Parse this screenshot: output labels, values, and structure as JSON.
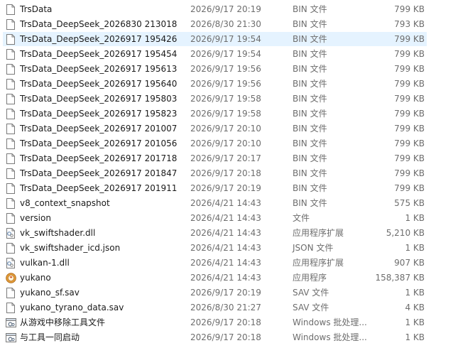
{
  "files": [
    {
      "name": "TrsData",
      "date": "2026/9/17 20:19",
      "type": "BIN 文件",
      "size": "799 KB",
      "icon": "blank-file-icon",
      "selected": false
    },
    {
      "name": "TrsData_DeepSeek_2026830 213018",
      "date": "2026/8/30 21:30",
      "type": "BIN 文件",
      "size": "793 KB",
      "icon": "blank-file-icon",
      "selected": false
    },
    {
      "name": "TrsData_DeepSeek_2026917 195426",
      "date": "2026/9/17 19:54",
      "type": "BIN 文件",
      "size": "799 KB",
      "icon": "blank-file-icon",
      "selected": true
    },
    {
      "name": "TrsData_DeepSeek_2026917 195454",
      "date": "2026/9/17 19:54",
      "type": "BIN 文件",
      "size": "799 KB",
      "icon": "blank-file-icon",
      "selected": false
    },
    {
      "name": "TrsData_DeepSeek_2026917 195613",
      "date": "2026/9/17 19:56",
      "type": "BIN 文件",
      "size": "799 KB",
      "icon": "blank-file-icon",
      "selected": false
    },
    {
      "name": "TrsData_DeepSeek_2026917 195640",
      "date": "2026/9/17 19:56",
      "type": "BIN 文件",
      "size": "799 KB",
      "icon": "blank-file-icon",
      "selected": false
    },
    {
      "name": "TrsData_DeepSeek_2026917 195803",
      "date": "2026/9/17 19:58",
      "type": "BIN 文件",
      "size": "799 KB",
      "icon": "blank-file-icon",
      "selected": false
    },
    {
      "name": "TrsData_DeepSeek_2026917 195823",
      "date": "2026/9/17 19:58",
      "type": "BIN 文件",
      "size": "799 KB",
      "icon": "blank-file-icon",
      "selected": false
    },
    {
      "name": "TrsData_DeepSeek_2026917 201007",
      "date": "2026/9/17 20:10",
      "type": "BIN 文件",
      "size": "799 KB",
      "icon": "blank-file-icon",
      "selected": false
    },
    {
      "name": "TrsData_DeepSeek_2026917 201056",
      "date": "2026/9/17 20:10",
      "type": "BIN 文件",
      "size": "799 KB",
      "icon": "blank-file-icon",
      "selected": false
    },
    {
      "name": "TrsData_DeepSeek_2026917 201718",
      "date": "2026/9/17 20:17",
      "type": "BIN 文件",
      "size": "799 KB",
      "icon": "blank-file-icon",
      "selected": false
    },
    {
      "name": "TrsData_DeepSeek_2026917 201847",
      "date": "2026/9/17 20:18",
      "type": "BIN 文件",
      "size": "799 KB",
      "icon": "blank-file-icon",
      "selected": false
    },
    {
      "name": "TrsData_DeepSeek_2026917 201911",
      "date": "2026/9/17 20:19",
      "type": "BIN 文件",
      "size": "799 KB",
      "icon": "blank-file-icon",
      "selected": false
    },
    {
      "name": "v8_context_snapshot",
      "date": "2026/4/21 14:43",
      "type": "BIN 文件",
      "size": "575 KB",
      "icon": "blank-file-icon",
      "selected": false
    },
    {
      "name": "version",
      "date": "2026/4/21 14:43",
      "type": "文件",
      "size": "1 KB",
      "icon": "blank-file-icon",
      "selected": false
    },
    {
      "name": "vk_swiftshader.dll",
      "date": "2026/4/21 14:43",
      "type": "应用程序扩展",
      "size": "5,210 KB",
      "icon": "dll-file-icon",
      "selected": false
    },
    {
      "name": "vk_swiftshader_icd.json",
      "date": "2026/4/21 14:43",
      "type": "JSON 文件",
      "size": "1 KB",
      "icon": "blank-file-icon",
      "selected": false
    },
    {
      "name": "vulkan-1.dll",
      "date": "2026/4/21 14:43",
      "type": "应用程序扩展",
      "size": "907 KB",
      "icon": "dll-file-icon",
      "selected": false
    },
    {
      "name": "yukano",
      "date": "2026/4/21 14:43",
      "type": "应用程序",
      "size": "158,387 KB",
      "icon": "app-icon",
      "selected": false
    },
    {
      "name": "yukano_sf.sav",
      "date": "2026/9/17 20:19",
      "type": "SAV 文件",
      "size": "1 KB",
      "icon": "blank-file-icon",
      "selected": false
    },
    {
      "name": "yukano_tyrano_data.sav",
      "date": "2026/8/30 21:27",
      "type": "SAV 文件",
      "size": "4 KB",
      "icon": "blank-file-icon",
      "selected": false
    },
    {
      "name": "从游戏中移除工具文件",
      "date": "2026/9/17 20:18",
      "type": "Windows 批处理...",
      "size": "1 KB",
      "icon": "batch-file-icon",
      "selected": false
    },
    {
      "name": "与工具一同启动",
      "date": "2026/9/17 20:18",
      "type": "Windows 批处理...",
      "size": "1 KB",
      "icon": "batch-file-icon",
      "selected": false
    }
  ]
}
